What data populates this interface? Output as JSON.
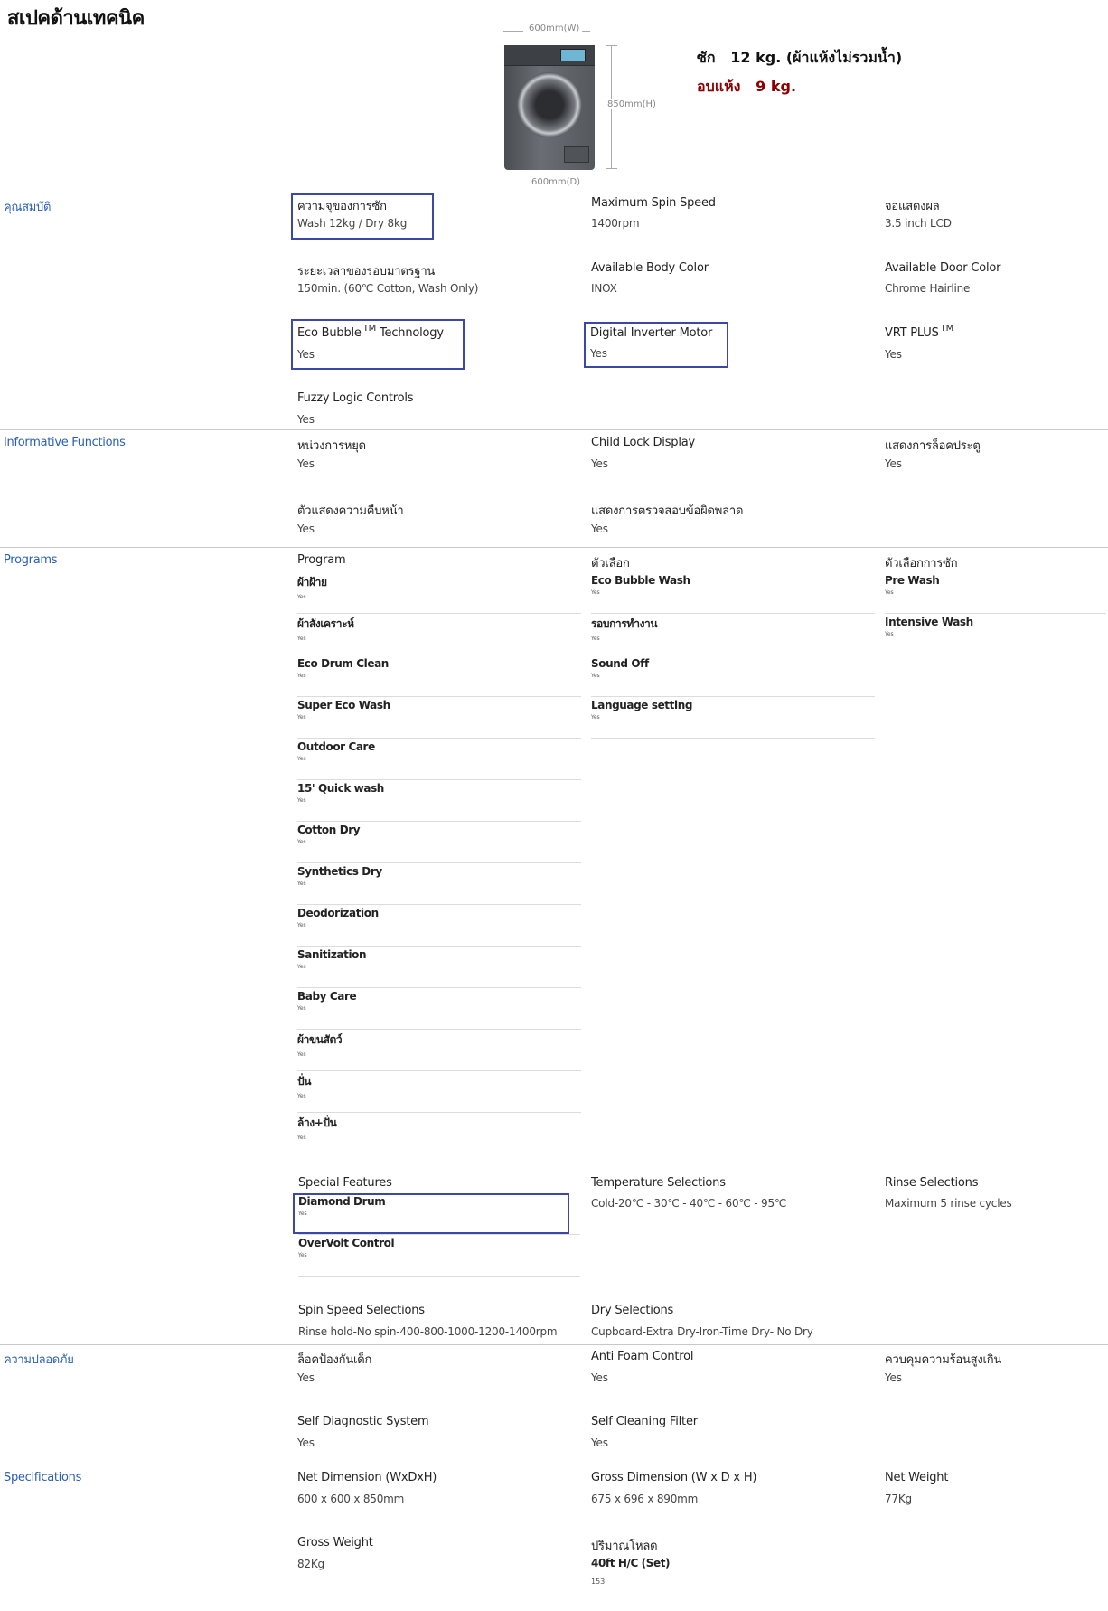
{
  "title": "สเปคด้านเทคนิค",
  "image": {
    "width_label": "600mm(W)",
    "height_label": "850mm(H)",
    "depth_label": "600mm(D)"
  },
  "capacity": {
    "wash": "ซัก   12 kg. (ผ้าแห้งไม่รวมน้ำ)",
    "dry": "อบแห้ง   9 kg."
  },
  "features": {
    "category": "คุณสมบัติ",
    "items": [
      {
        "label": "ความจุของการซัก",
        "value": "Wash 12kg / Dry 8kg"
      },
      {
        "label": "Maximum Spin Speed",
        "value": "1400rpm"
      },
      {
        "label": "จอแสดงผล",
        "value": "3.5 inch LCD"
      },
      {
        "label": "ระยะเวลาของรอบมาตรฐาน",
        "value": "150min. (60℃ Cotton, Wash Only)"
      },
      {
        "label": "Available Body Color",
        "value": "INOX"
      },
      {
        "label": "Available Door Color",
        "value": "Chrome Hairline"
      },
      {
        "label": "Eco Bubble",
        "label_tm": "TM",
        "label_suffix": " Technology",
        "value": "Yes"
      },
      {
        "label": "Digital Inverter Motor",
        "value": "Yes"
      },
      {
        "label": "VRT PLUS",
        "label_tm": "TM",
        "value": "Yes"
      },
      {
        "label": "Fuzzy Logic Controls",
        "value": "Yes"
      }
    ]
  },
  "informative": {
    "category": "Informative Functions",
    "items": [
      {
        "label": "หน่วงการหยุด",
        "value": "Yes"
      },
      {
        "label": "Child Lock Display",
        "value": "Yes"
      },
      {
        "label": "แสดงการล็อคประตู",
        "value": "Yes"
      },
      {
        "label": "ตัวแสดงความคืบหน้า",
        "value": "Yes"
      },
      {
        "label": "แสดงการตรวจสอบข้อผิดพลาด",
        "value": "Yes"
      }
    ]
  },
  "programs": {
    "category": "Programs",
    "col1_title": "Program",
    "col1": [
      {
        "label": "ผ้าฝ้าย",
        "value": "Yes"
      },
      {
        "label": "ผ้าสังเคราะห์",
        "value": "Yes"
      },
      {
        "label": "Eco Drum Clean",
        "value": "Yes"
      },
      {
        "label": "Super Eco Wash",
        "value": "Yes"
      },
      {
        "label": "Outdoor Care",
        "value": "Yes"
      },
      {
        "label": "15' Quick wash",
        "value": "Yes"
      },
      {
        "label": "Cotton Dry",
        "value": "Yes"
      },
      {
        "label": "Synthetics Dry",
        "value": "Yes"
      },
      {
        "label": "Deodorization",
        "value": "Yes"
      },
      {
        "label": "Sanitization",
        "value": "Yes"
      },
      {
        "label": "Baby Care",
        "value": "Yes"
      },
      {
        "label": "ผ้าขนสัตว์",
        "value": "Yes"
      },
      {
        "label": "ปั่น",
        "value": "Yes"
      },
      {
        "label": "ล้าง+ปั่น",
        "value": "Yes"
      }
    ],
    "col2_title": "ตัวเลือก",
    "col2": [
      {
        "label": "Eco Bubble Wash",
        "value": "Yes"
      },
      {
        "label": "รอบการทำงาน",
        "value": "Yes"
      },
      {
        "label": "Sound Off",
        "value": "Yes"
      },
      {
        "label": "Language setting",
        "value": "Yes"
      }
    ],
    "col3_title": "ตัวเลือกการซัก",
    "col3": [
      {
        "label": "Pre Wash",
        "value": "Yes"
      },
      {
        "label": "Intensive Wash",
        "value": "Yes"
      }
    ],
    "special_title": "Special Features",
    "special": [
      {
        "label": "Diamond Drum",
        "value": "Yes"
      },
      {
        "label": "OverVolt Control",
        "value": "Yes"
      }
    ],
    "temp": {
      "label": "Temperature Selections",
      "value": "Cold-20℃ - 30℃ - 40℃ - 60℃ - 95℃"
    },
    "rinse": {
      "label": "Rinse Selections",
      "value": "Maximum 5 rinse cycles"
    },
    "spin": {
      "label": "Spin Speed Selections",
      "value": "Rinse hold-No spin-400-800-1000-1200-1400rpm"
    },
    "dry": {
      "label": "Dry Selections",
      "value": "Cupboard-Extra Dry-Iron-Time Dry- No Dry"
    }
  },
  "safety": {
    "category": "ความปลอดภัย",
    "items": [
      {
        "label": "ล็อคป้องกันเด็ก",
        "value": "Yes"
      },
      {
        "label": "Anti Foam Control",
        "value": "Yes"
      },
      {
        "label": "ควบคุมความร้อนสูงเกิน",
        "value": "Yes"
      },
      {
        "label": "Self Diagnostic System",
        "value": "Yes"
      },
      {
        "label": "Self Cleaning Filter",
        "value": "Yes"
      }
    ]
  },
  "specifications": {
    "category": "Specifications",
    "items": [
      {
        "label": "Net Dimension (WxDxH)",
        "value": "600 x 600 x 850mm"
      },
      {
        "label": "Gross Dimension (W x D x H)",
        "value": "675 x 696 x 890mm"
      },
      {
        "label": "Net Weight",
        "value": "77Kg"
      },
      {
        "label": "Gross Weight",
        "value": "82Kg"
      },
      {
        "label": "ปริมาณโหลด",
        "sub": "40ft H/C (Set)",
        "value": "153"
      }
    ]
  },
  "colors": {
    "category": "#2b5fb4",
    "highlight": "#3b48a6",
    "dry_red": "#8b0000"
  }
}
